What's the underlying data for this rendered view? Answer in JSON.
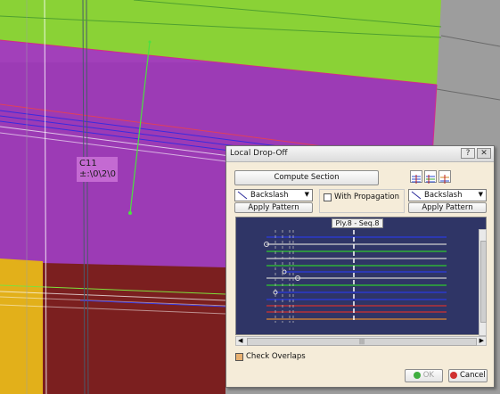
{
  "canvas": {
    "annotation_lines": [
      "C11",
      "±:\\0\\2\\0"
    ]
  },
  "dialog": {
    "title": "Local Drop-Off",
    "help_label": "?",
    "close_label": "✕",
    "compute_section_label": "Compute Section",
    "left_pattern": {
      "value": "Backslash",
      "apply_label": "Apply Pattern"
    },
    "right_pattern": {
      "value": "Backslash",
      "apply_label": "Apply Pattern"
    },
    "with_propagation_label": "With Propagation",
    "with_propagation_checked": false,
    "view_icons": [
      "section-view-icon",
      "table-view-icon",
      "alignment-view-icon"
    ],
    "plot_title": "Ply.8 - Seq.8",
    "hscroll_grip": "|||",
    "check_overlaps_label": "Check Overlaps",
    "check_overlaps_checked": false,
    "ok_label": "OK",
    "cancel_label": "Cancel"
  },
  "colors": {
    "green_surface": "#8fd63a",
    "purple_surface": "#9b3bb4",
    "maroon_surface": "#7a2020",
    "yellow_surface": "#e4b21a",
    "plot_background": "#2f3566"
  }
}
